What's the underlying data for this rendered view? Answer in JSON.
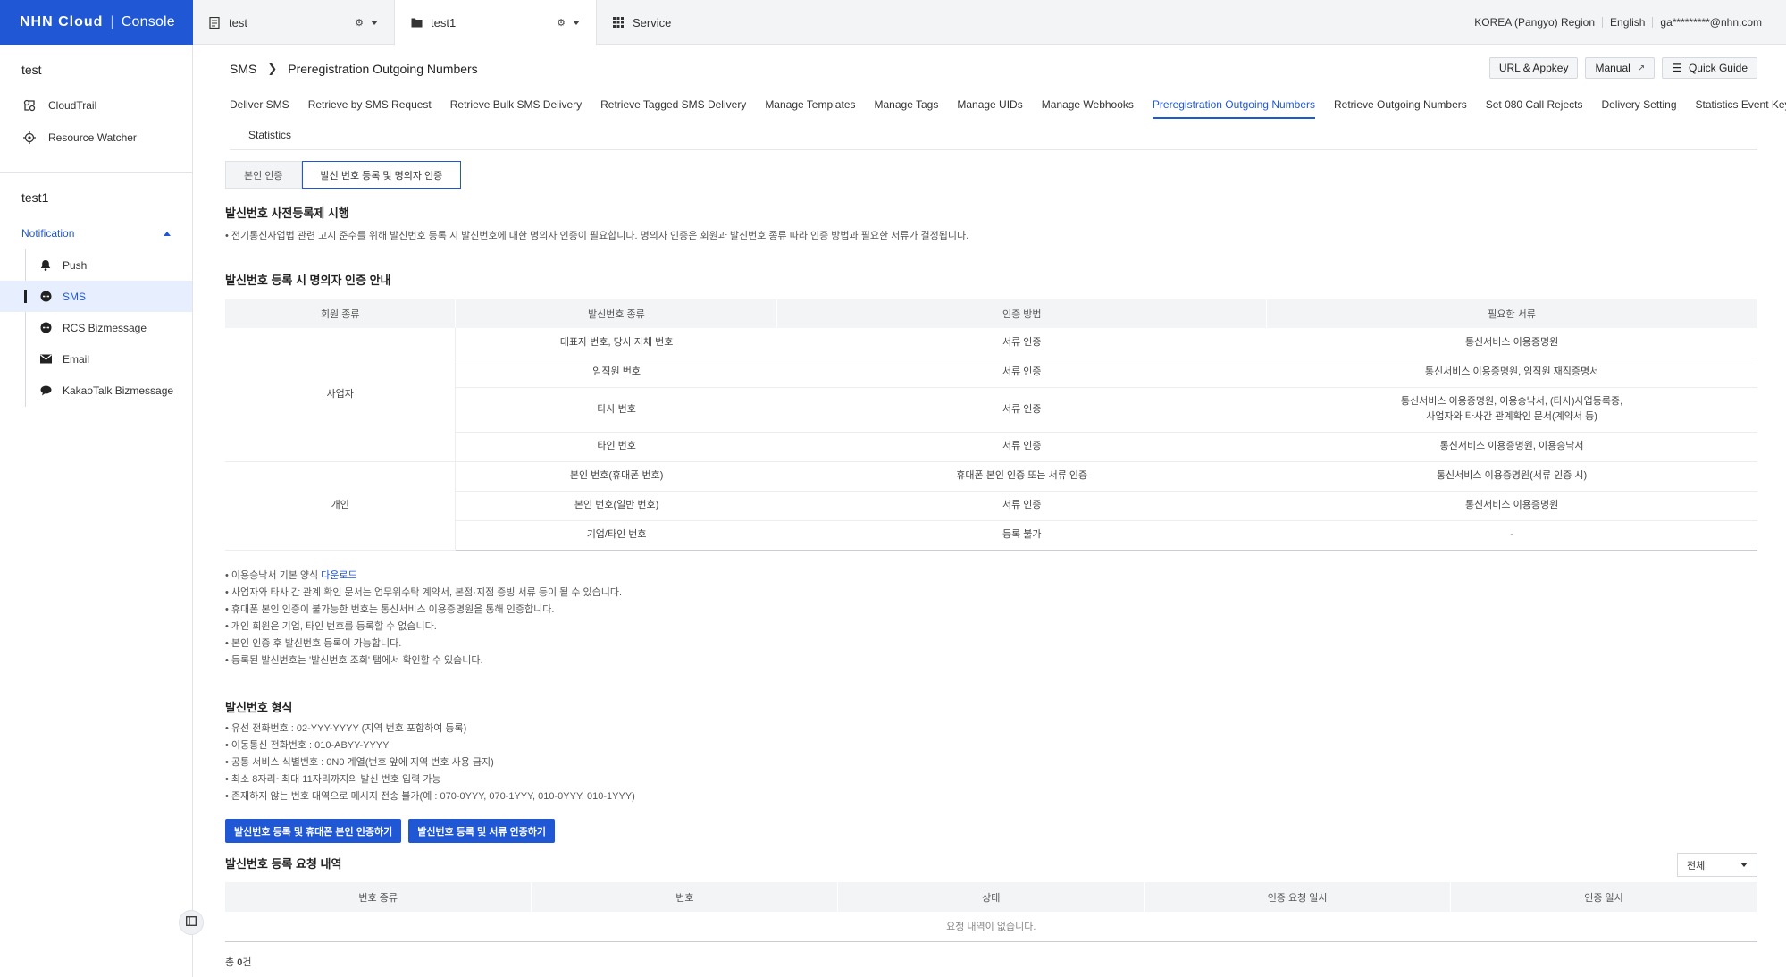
{
  "brand": {
    "logo": "NHN Cloud",
    "console": "Console"
  },
  "top_tabs": [
    {
      "label": "test"
    },
    {
      "label": "test1"
    },
    {
      "label": "Service"
    }
  ],
  "top_right": {
    "region": "KOREA (Pangyo) Region",
    "language": "English",
    "user": "ga*********@nhn.com"
  },
  "sidebar": {
    "project1": "test",
    "project1_items": [
      {
        "label": "CloudTrail",
        "icon": "cloudtrail-icon"
      },
      {
        "label": "Resource Watcher",
        "icon": "resource-watcher-icon"
      }
    ],
    "project2": "test1",
    "group": "Notification",
    "group_items": [
      {
        "label": "Push",
        "icon": "bell-icon"
      },
      {
        "label": "SMS",
        "icon": "sms-icon"
      },
      {
        "label": "RCS Bizmessage",
        "icon": "rcs-icon"
      },
      {
        "label": "Email",
        "icon": "mail-icon"
      },
      {
        "label": "KakaoTalk Bizmessage",
        "icon": "chat-bubble-icon"
      }
    ]
  },
  "breadcrumb": {
    "service": "SMS",
    "page": "Preregistration Outgoing Numbers"
  },
  "header_buttons": {
    "url_appkey": "URL & Appkey",
    "manual": "Manual",
    "quick_guide": "Quick Guide"
  },
  "menu_tabs": [
    "Deliver SMS",
    "Retrieve by SMS Request",
    "Retrieve Bulk SMS Delivery",
    "Retrieve Tagged SMS Delivery",
    "Manage Templates",
    "Manage Tags",
    "Manage UIDs",
    "Manage Webhooks",
    "Preregistration Outgoing Numbers",
    "Retrieve Outgoing Numbers",
    "Set 080 Call Rejects",
    "Delivery Setting",
    "Statistics Event Key"
  ],
  "menu_tabs_row2": [
    "Statistics"
  ],
  "sub_tabs": [
    "본인 인증",
    "발신 번호 등록 및 명의자 인증"
  ],
  "section1": {
    "title": "발신번호 사전등록제 시행",
    "note": "전기통신사업법 관련 고시 준수를 위해 발신번호 등록 시 발신번호에 대한 명의자 인증이 필요합니다. 명의자 인증은 회원과 발신번호 종류 따라 인증 방법과 필요한 서류가 결정됩니다."
  },
  "section2": {
    "title": "발신번호 등록 시 명의자 인증 안내",
    "headers": [
      "회원 종류",
      "발신번호 종류",
      "인증 방법",
      "필요한 서류"
    ],
    "groups": [
      {
        "member": "사업자",
        "rows": [
          {
            "type": "대표자 번호, 당사 자체 번호",
            "method": "서류 인증",
            "docs": "통신서비스 이용증명원"
          },
          {
            "type": "임직원 번호",
            "method": "서류 인증",
            "docs": "통신서비스 이용증명원, 임직원 재직증명서"
          },
          {
            "type": "타사 번호",
            "method": "서류 인증",
            "docs": "통신서비스 이용증명원, 이용승낙서, (타사)사업등록증,",
            "docs2": "사업자와 타사간 관계확인 문서(계약서 등)"
          },
          {
            "type": "타인 번호",
            "method": "서류 인증",
            "docs": "통신서비스 이용증명원, 이용승낙서"
          }
        ]
      },
      {
        "member": "개인",
        "rows": [
          {
            "type": "본인 번호(휴대폰 번호)",
            "method": "휴대폰 본인 인증 또는 서류 인증",
            "docs": "통신서비스 이용증명원(서류 인증 시)"
          },
          {
            "type": "본인 번호(일반 번호)",
            "method": "서류 인증",
            "docs": "통신서비스 이용증명원"
          },
          {
            "type": "기업/타인 번호",
            "method": "등록 불가",
            "docs": "-"
          }
        ]
      }
    ]
  },
  "notes": {
    "download_prefix": "이용승낙서 기본 양식 ",
    "download_link": "다운로드",
    "items": [
      "사업자와 타사 간 관계 확인 문서는 업무위수탁 계약서, 본점·지점 증빙 서류 등이 될 수 있습니다.",
      "휴대폰 본인 인증이 불가능한 번호는 통신서비스 이용증명원을 통해 인증합니다.",
      "개인 회원은 기업, 타인 번호를 등록할 수 없습니다.",
      "본인 인증 후 발신번호 등록이 가능합니다.",
      "등록된 발신번호는 '발신번호 조회' 탭에서 확인할 수 있습니다."
    ]
  },
  "section3": {
    "title": "발신번호 형식",
    "items": [
      "유선 전화번호 : 02-YYY-YYYY (지역 번호 포함하여 등록)",
      "이동통신 전화번호 : 010-ABYY-YYYY",
      "공통 서비스 식별번호 : 0N0 계열(번호 앞에 지역 번호 사용 금지)",
      "최소 8자리~최대 11자리까지의 발신 번호 입력 가능",
      "존재하지 않는 번호 대역으로 메시지 전송 불가(예 : 070-0YYY, 070-1YYY, 010-0YYY, 010-1YYY)"
    ]
  },
  "buttons": {
    "mobile_auth": "발신번호 등록 및 휴대폰 본인 인증하기",
    "doc_auth": "발신번호 등록 및 서류 인증하기"
  },
  "section4": {
    "title": "발신번호 등록 요청 내역",
    "filter_value": "전체",
    "headers": [
      "번호 종류",
      "번호",
      "상태",
      "인증 요청 일시",
      "인증 일시"
    ],
    "empty": "요청 내역이 없습니다.",
    "total_prefix": "총 ",
    "total_count": "0",
    "total_suffix": "건"
  },
  "colors": {
    "accent": "#1f57d4",
    "topbar": "#f3f4f6",
    "active_nav": "#e7efff"
  }
}
